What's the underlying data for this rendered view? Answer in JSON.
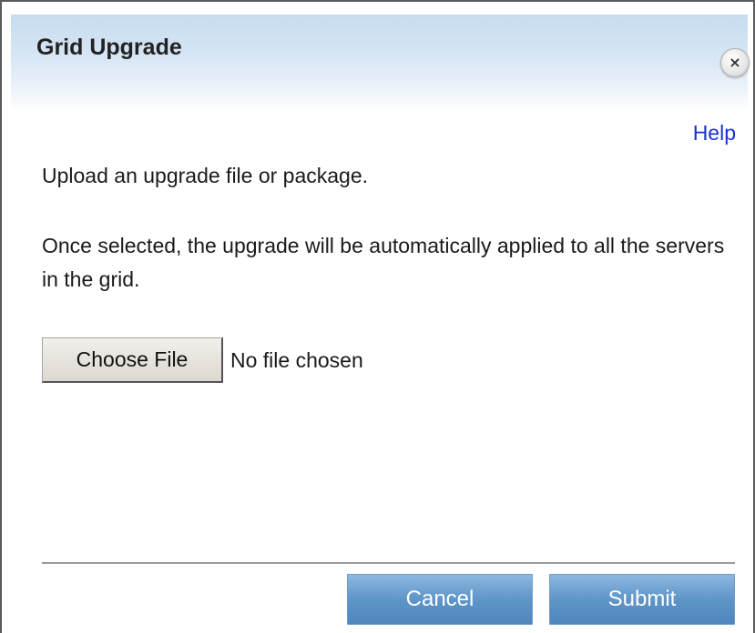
{
  "dialog": {
    "title": "Grid Upgrade",
    "close_icon": "close-icon",
    "help_label": "Help",
    "intro_text": "Upload an upgrade file or package.",
    "info_text": "Once selected, the upgrade will be automatically applied to all the servers in the grid.",
    "file_input": {
      "button_label": "Choose File",
      "status": "No file chosen"
    },
    "buttons": {
      "cancel_label": "Cancel",
      "submit_label": "Submit"
    }
  },
  "colors": {
    "header_gradient_top": "#c6dcef",
    "help_link": "#1a33cc",
    "footer_button": "#5f95c8"
  }
}
